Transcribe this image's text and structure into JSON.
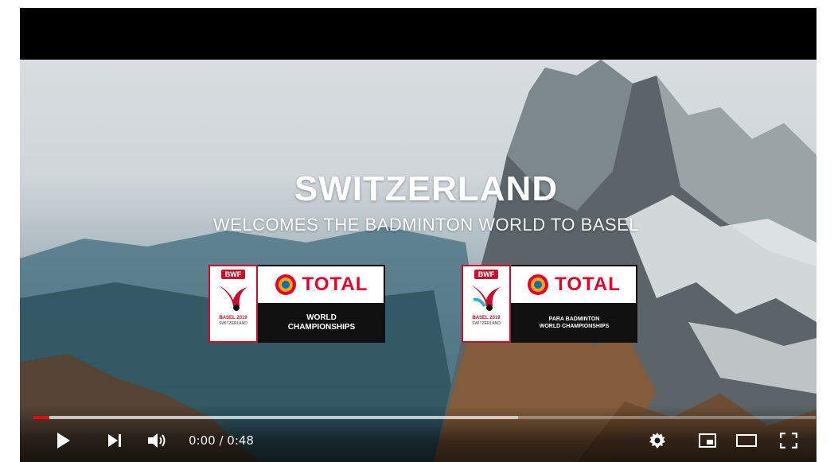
{
  "video": {
    "headline": "SWITZERLAND",
    "subheadline": "WELCOMES THE BADMINTON WORLD TO BASEL"
  },
  "logos": [
    {
      "badge_top": "BWF",
      "badge_city": "BASEL 2019",
      "badge_country": "SWITZERLAND",
      "brand": "TOTAL",
      "event_lines": [
        "WORLD",
        "CHAMPIONSHIPS"
      ]
    },
    {
      "badge_top": "BWF",
      "badge_city": "BASEL 2019",
      "badge_country": "SWITZERLAND",
      "brand": "TOTAL",
      "event_lines": [
        "PARA BADMINTON",
        "WORLD CHAMPIONSHIPS"
      ]
    }
  ],
  "controls": {
    "time_display": "0:00 / 0:48",
    "progress_played": 0.02,
    "progress_buffered": 0.62,
    "icons": {
      "play": "play-icon",
      "next": "next-icon",
      "volume": "volume-icon",
      "settings": "gear-icon",
      "miniplayer": "miniplayer-icon",
      "theater": "theater-mode-icon",
      "fullscreen": "fullscreen-icon"
    }
  },
  "colors": {
    "progress_played": "#ff0000",
    "brand_red": "#e4002b",
    "badge_red": "#c8102e"
  }
}
